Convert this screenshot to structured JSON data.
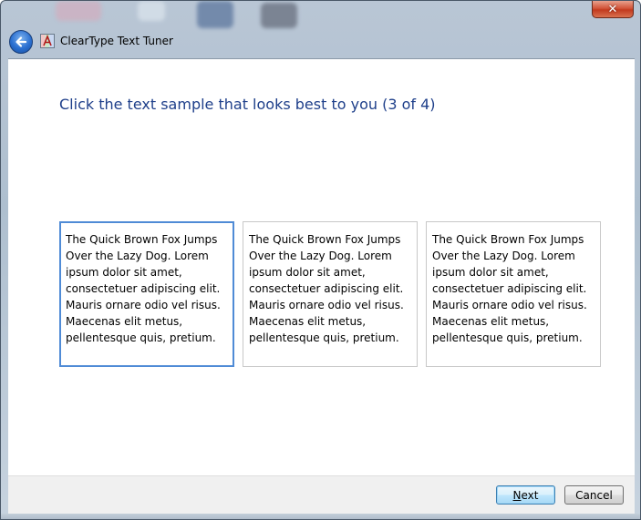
{
  "window": {
    "title": "ClearType Text Tuner",
    "close_glyph": "✕",
    "back_icon": "back-arrow-icon",
    "app_icon": "cleartype-app-icon"
  },
  "main": {
    "heading": "Click the text sample that looks best to you (3 of 4)",
    "samples": [
      {
        "text": "The Quick Brown Fox Jumps Over the Lazy Dog. Lorem ipsum dolor sit amet, consectetuer adipiscing elit. Mauris ornare odio vel risus. Maecenas elit metus, pellentesque quis, pretium.",
        "selected": true
      },
      {
        "text": "The Quick Brown Fox Jumps Over the Lazy Dog. Lorem ipsum dolor sit amet, consectetuer adipiscing elit. Mauris ornare odio vel risus. Maecenas elit metus, pellentesque quis, pretium.",
        "selected": false
      },
      {
        "text": "The Quick Brown Fox Jumps Over the Lazy Dog. Lorem ipsum dolor sit amet, consectetuer adipiscing elit. Mauris ornare odio vel risus. Maecenas elit metus, pellentesque quis, pretium.",
        "selected": false
      }
    ]
  },
  "footer": {
    "next_first": "N",
    "next_rest": "ext",
    "cancel_label": "Cancel"
  },
  "colors": {
    "heading": "#1e3f8a",
    "selected_border": "#4f8bd6",
    "close_button": "#c23a1e"
  }
}
